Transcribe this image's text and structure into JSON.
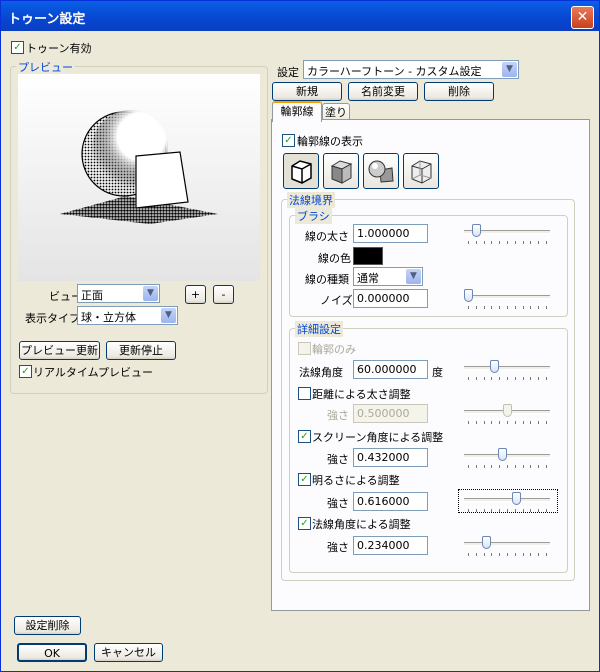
{
  "window": {
    "title": "トゥーン設定",
    "close_glyph": "✕"
  },
  "toon_enabled": {
    "label": "トゥーン有効",
    "checked": true
  },
  "preview_group": {
    "title": "プレビュー",
    "view_label": "ビュー",
    "view_value": "正面",
    "plus_label": "+",
    "minus_label": "-",
    "display_type_label": "表示タイプ",
    "display_type_value": "球・立方体",
    "update_button": "プレビュー更新",
    "stop_button": "更新停止",
    "realtime": {
      "label": "リアルタイムプレビュー",
      "checked": true
    }
  },
  "settings": {
    "label": "設定",
    "value": "カラーハーフトーン - カスタム設定",
    "new_button": "新規",
    "rename_button": "名前変更",
    "delete_button": "削除"
  },
  "tabs": [
    {
      "label": "輪郭線",
      "active": true
    },
    {
      "label": "塗り",
      "active": false
    }
  ],
  "outline": {
    "show": {
      "label": "輪郭線の表示",
      "checked": true
    },
    "mode_icons": [
      "cube-outline-icon",
      "cube-shaded-icon",
      "sphere-cube-icon",
      "cube-wire-icon"
    ],
    "normal_boundary": {
      "title": "法線境界",
      "brush": {
        "title": "ブラシ",
        "width_label": "線の太さ",
        "width_value": "1.000000",
        "width_slider": 0.1,
        "color_label": "線の色",
        "color": "#000000",
        "type_label": "線の種類",
        "type_value": "通常",
        "noise_label": "ノイズ",
        "noise_value": "0.000000",
        "noise_slider": 0.0
      },
      "detail": {
        "title": "詳細設定",
        "outline_only": {
          "label": "輪郭のみ",
          "checked": false,
          "disabled": true
        },
        "normal_angle_label": "法線角度",
        "normal_angle_value": "60.000000",
        "normal_angle_unit": "度",
        "normal_angle_slider": 0.33,
        "distance": {
          "label": "距離による太さ調整",
          "checked": false
        },
        "distance_strength_label": "強さ",
        "distance_strength_value": "0.500000",
        "distance_strength_slider": 0.5,
        "screen_angle": {
          "label": "スクリーン角度による調整",
          "checked": true
        },
        "screen_strength_label": "強さ",
        "screen_strength_value": "0.432000",
        "screen_strength_slider": 0.43,
        "brightness": {
          "label": "明るさによる調整",
          "checked": true
        },
        "brightness_strength_label": "強さ",
        "brightness_strength_value": "0.616000",
        "brightness_strength_slider": 0.62,
        "normal_adjust": {
          "label": "法線角度による調整",
          "checked": true
        },
        "normal_strength_label": "強さ",
        "normal_strength_value": "0.234000",
        "normal_strength_slider": 0.23
      }
    }
  },
  "footer": {
    "delete_settings_button": "設定削除",
    "ok_button": "OK",
    "cancel_button": "キャンセル"
  },
  "colors": {
    "title_bar": "#0a5fe6",
    "group_title": "#0046d5",
    "check": "#21a121",
    "close": "#c9401c"
  }
}
